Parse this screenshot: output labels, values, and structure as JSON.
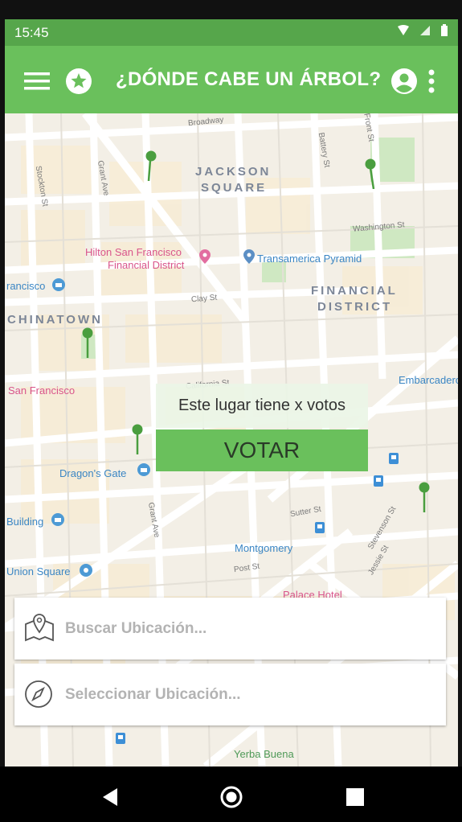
{
  "status_bar": {
    "time": "15:45"
  },
  "app_bar": {
    "title": "¿DÓNDE CABE UN ÁRBOL?",
    "icons": [
      "menu-icon",
      "star-icon",
      "account-icon",
      "more-vert-icon"
    ]
  },
  "map": {
    "areas": [
      "JACKSON",
      "SQUARE",
      "FINANCIAL",
      "DISTRICT",
      "CHINATOWN"
    ],
    "streets": [
      "Broadway",
      "Stockton St",
      "Grant Ave",
      "Battery St",
      "Front St",
      "Washington St",
      "Clay St",
      "California St",
      "Sutter St",
      "Post St",
      "Stevenson St",
      "Jessie St",
      "Grant Ave"
    ],
    "pois": [
      "Transamerica Pyramid",
      "Dragon's Gate",
      "Montgomery",
      "Embarcadero",
      "Building",
      "Union Square",
      "rancisco",
      "Yerba Buena"
    ],
    "pink_pois": [
      "Hilton San Francisco",
      "Financial District",
      "San Francisco",
      "Palace Hotel"
    ],
    "pins": 6
  },
  "popup": {
    "text": "Este lugar tiene x votos",
    "button": "VOTAR"
  },
  "search": {
    "search_placeholder": "Buscar Ubicación...",
    "select_placeholder": "Seleccionar Ubicación..."
  },
  "colors": {
    "primary": "#6ac05c",
    "status": "#56a64b",
    "pin": "#4a9e3f"
  },
  "nav": {
    "icons": [
      "back-icon",
      "home-icon",
      "recents-icon"
    ]
  }
}
